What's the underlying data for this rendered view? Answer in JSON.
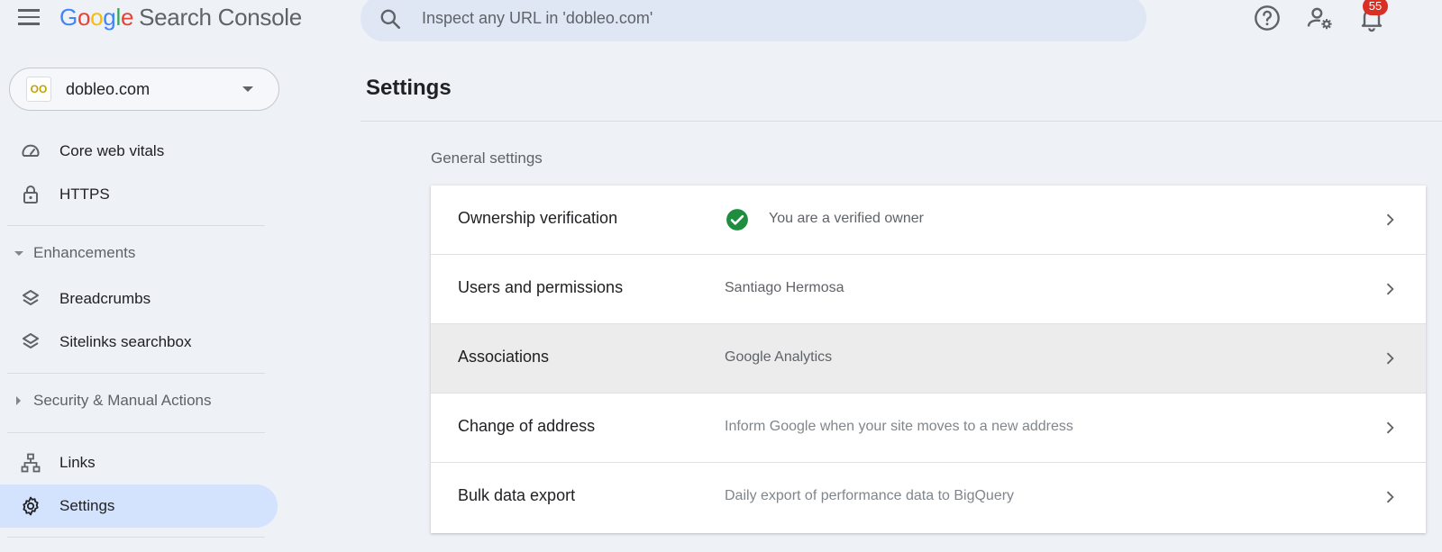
{
  "header": {
    "logo_letters": [
      "G",
      "o",
      "o",
      "g",
      "l",
      "e"
    ],
    "logo_product": "Search Console",
    "search_placeholder": "Inspect any URL in 'dobleo.com'",
    "notification_count": "55"
  },
  "sidebar": {
    "property": {
      "name": "dobleo.com",
      "icon_text": "OO"
    },
    "items": [
      {
        "label": "Core web vitals",
        "icon": "speedometer-icon"
      },
      {
        "label": "HTTPS",
        "icon": "lock-icon"
      }
    ],
    "enhancements": {
      "label": "Enhancements",
      "items": [
        {
          "label": "Breadcrumbs",
          "icon": "layers-icon"
        },
        {
          "label": "Sitelinks searchbox",
          "icon": "layers-icon"
        }
      ]
    },
    "security": {
      "label": "Security & Manual Actions"
    },
    "links": {
      "label": "Links",
      "icon": "links-icon"
    },
    "settings": {
      "label": "Settings",
      "icon": "gear-icon"
    }
  },
  "main": {
    "title": "Settings",
    "section_title": "General settings",
    "rows": [
      {
        "label": "Ownership verification",
        "value": "You are a verified owner"
      },
      {
        "label": "Users and permissions",
        "value": "Santiago Hermosa"
      },
      {
        "label": "Associations",
        "value": "Google Analytics"
      },
      {
        "label": "Change of address",
        "value": "Inform Google when your site moves to a new address"
      },
      {
        "label": "Bulk data export",
        "value": "Daily export of performance data to BigQuery"
      }
    ]
  },
  "colors": {
    "accent_active": "#d3e3fd",
    "verified_green": "#1e8e3e",
    "badge_red": "#d93025"
  }
}
